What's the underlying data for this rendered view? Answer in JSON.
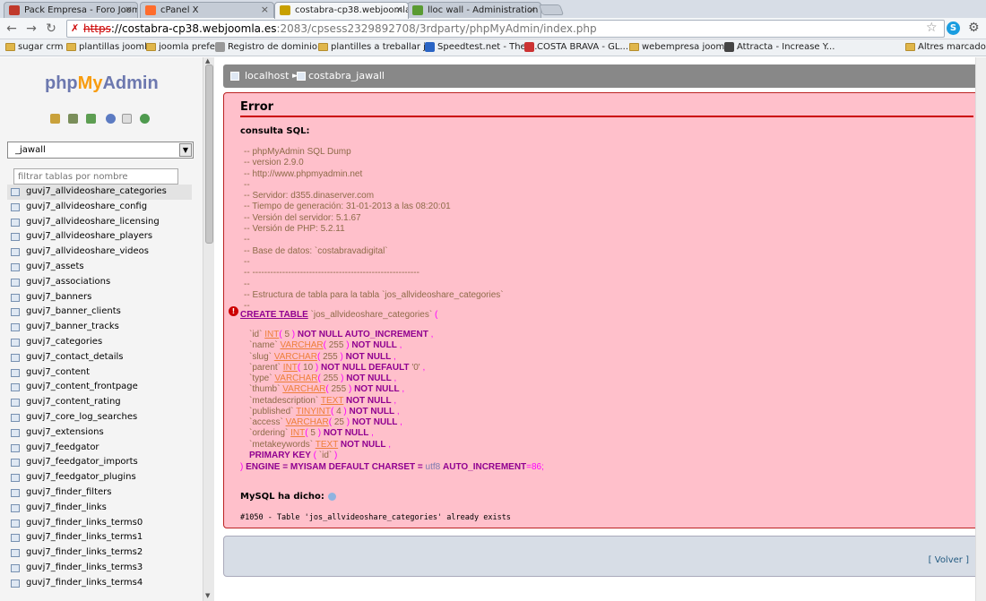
{
  "browser": {
    "tabs": [
      {
        "label": "Pack Empresa - Foro Joom",
        "favicon": "webempresa-icon",
        "fav_color": "#c0392b"
      },
      {
        "label": "cPanel X",
        "favicon": "cpanel-icon",
        "fav_color": "#ff6c2c"
      },
      {
        "label": "costabra-cp38.webjoomla",
        "favicon": "phpmyadmin-icon",
        "fav_color": "#c8a000"
      },
      {
        "label": "lloc wall - Administration",
        "favicon": "joomla-icon",
        "fav_color": "#5a9b32"
      }
    ],
    "url": {
      "protocol": "https",
      "host": "://costabra-cp38.webjoomla.es",
      "rest": ":2083/cpsess2329892708/3rdparty/phpMyAdmin/index.php"
    },
    "bookmarks": [
      {
        "label": "sugar crm",
        "icon": "folder-icon"
      },
      {
        "label": "plantillas joomla",
        "icon": "folder-icon"
      },
      {
        "label": "joomla prefer",
        "icon": "folder-icon"
      },
      {
        "label": "Registro de dominio...",
        "icon": "page-icon"
      },
      {
        "label": "plantilles a treballar j...",
        "icon": "folder-icon"
      },
      {
        "label": "Speedtest.net - The ...",
        "icon": "speedtest-icon"
      },
      {
        "label": "COSTA BRAVA - GL...",
        "icon": "cube-icon"
      },
      {
        "label": "webempresa joomla",
        "icon": "folder-icon"
      },
      {
        "label": "Attracta - Increase Y...",
        "icon": "attracta-icon"
      },
      {
        "label": "Altres marcadors",
        "icon": "folder-icon"
      }
    ]
  },
  "left": {
    "logo": {
      "php": "php",
      "my": "My",
      "admin": "Admin"
    },
    "db_select": "_jawall",
    "filter_placeholder": "filtrar tablas por nombre",
    "tables": [
      "guvj7_allvideoshare_categories",
      "guvj7_allvideoshare_config",
      "guvj7_allvideoshare_licensing",
      "guvj7_allvideoshare_players",
      "guvj7_allvideoshare_videos",
      "guvj7_assets",
      "guvj7_associations",
      "guvj7_banners",
      "guvj7_banner_clients",
      "guvj7_banner_tracks",
      "guvj7_categories",
      "guvj7_contact_details",
      "guvj7_content",
      "guvj7_content_frontpage",
      "guvj7_content_rating",
      "guvj7_core_log_searches",
      "guvj7_extensions",
      "guvj7_feedgator",
      "guvj7_feedgator_imports",
      "guvj7_feedgator_plugins",
      "guvj7_finder_filters",
      "guvj7_finder_links",
      "guvj7_finder_links_terms0",
      "guvj7_finder_links_terms1",
      "guvj7_finder_links_terms2",
      "guvj7_finder_links_terms3",
      "guvj7_finder_links_terms4"
    ]
  },
  "breadcrumb": {
    "server": "localhost",
    "database": "costabra_jawall"
  },
  "error": {
    "title": "Error",
    "sql_label": "consulta SQL:",
    "comments": "-- phpMyAdmin SQL Dump\n-- version 2.9.0\n-- http://www.phpmyadmin.net\n--\n-- Servidor: d355.dinaserver.com\n-- Tiempo de generación: 31-01-2013 a las 08:20:01\n-- Versión del servidor: 5.1.67\n-- Versión de PHP: 5.2.11\n--\n-- Base de datos: `costabravadigital`\n--\n-- --------------------------------------------------------\n--\n-- Estructura de tabla para la tabla `jos_allvideoshare_categories`\n--",
    "create_kw": "CREATE TABLE",
    "table_name": "`jos_allvideoshare_categories`",
    "columns": [
      {
        "name": "`id`",
        "type": "INT",
        "size": "5",
        "rest": "NOT NULL AUTO_INCREMENT"
      },
      {
        "name": "`name`",
        "type": "VARCHAR",
        "size": "255",
        "rest": "NOT NULL"
      },
      {
        "name": "`slug`",
        "type": "VARCHAR",
        "size": "255",
        "rest": "NOT NULL"
      },
      {
        "name": "`parent`",
        "type": "INT",
        "size": "10",
        "rest": "NOT NULL DEFAULT",
        "default": "'0'"
      },
      {
        "name": "`type`",
        "type": "VARCHAR",
        "size": "255",
        "rest": "NOT NULL"
      },
      {
        "name": "`thumb`",
        "type": "VARCHAR",
        "size": "255",
        "rest": "NOT NULL"
      },
      {
        "name": "`metadescription`",
        "type": "TEXT",
        "size": "",
        "rest": "NOT NULL"
      },
      {
        "name": "`published`",
        "type": "TINYINT",
        "size": "4",
        "rest": "NOT NULL"
      },
      {
        "name": "`access`",
        "type": "VARCHAR",
        "size": "25",
        "rest": "NOT NULL"
      },
      {
        "name": "`ordering`",
        "type": "INT",
        "size": "5",
        "rest": "NOT NULL"
      },
      {
        "name": "`metakeywords`",
        "type": "TEXT",
        "size": "",
        "rest": "NOT NULL"
      }
    ],
    "primary_key": "PRIMARY KEY",
    "primary_col": "`id`",
    "engine_kw": "ENGINE = MYISAM DEFAULT CHARSET =",
    "charset": "utf8",
    "auto_inc_kw": "AUTO_INCREMENT",
    "auto_inc_val": "=86;",
    "mysql_said": "MySQL ha dicho:",
    "message": "#1050 - Table 'jos_allvideoshare_categories' already exists"
  },
  "footer": {
    "back": "Volver"
  }
}
